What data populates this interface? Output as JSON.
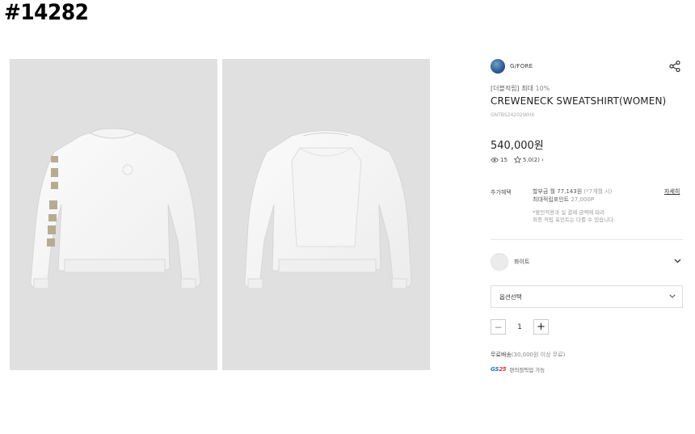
{
  "stamp": "#14282",
  "gallery": {
    "front_alt": "front view",
    "back_alt": "back view"
  },
  "brand": {
    "name": "G/FORE",
    "logo_icon": "brand-logo-icon"
  },
  "share_icon": "share-icon",
  "product": {
    "promo_tag": "[더블적립] 최대",
    "promo_pct": "10%",
    "title": "CREWENECK SWEATSHIRT(WOMEN)",
    "sku": "GNTBS24202WHX",
    "price": "540,000원",
    "likes": "15",
    "rating": "5.0(2)",
    "rating_chevron": "›"
  },
  "benefits": {
    "label": "추가혜택",
    "installment": "할부금 월 77,143원",
    "installment_note": "(*7개월 시)",
    "points_label": "최대적립포인트",
    "points_value": "27,000P",
    "note_line1": "*할인적용과 실 결제 금액에 따라",
    "note_line2": "최종 적립 포인트는 다를 수 있습니다.",
    "detail_link": "자세히"
  },
  "color": {
    "name": "화이트",
    "swatch": "#ebebeb"
  },
  "option_select": {
    "placeholder": "옵션선택"
  },
  "quantity": {
    "minus": "−",
    "value": "1",
    "plus": "+"
  },
  "shipping": {
    "label": "무료배송",
    "condition": "(30,000원 이상 무료)"
  },
  "pickup": {
    "logo_gs": "GS",
    "logo_num": "25",
    "text": "편의점픽업 가능"
  }
}
